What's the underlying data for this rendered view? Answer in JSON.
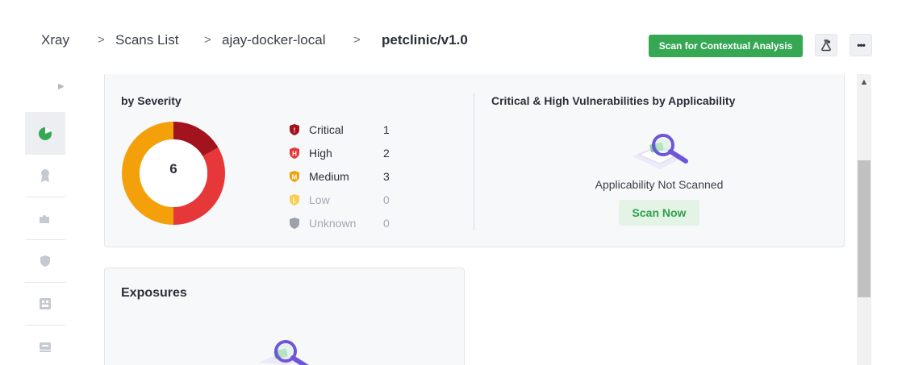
{
  "breadcrumb": {
    "items": [
      "Xray",
      "Scans List",
      "ajay-docker-local",
      "petclinic/v1.0"
    ],
    "separator": ">"
  },
  "header": {
    "contextual_button": "Scan for Contextual Analysis",
    "icons": [
      "lab-flask-icon",
      "more-options-icon"
    ],
    "more_label": "•••"
  },
  "rail": {
    "toggle_icon": "expand-arrow-icon",
    "items": [
      "pie-chart-icon",
      "award-badge-icon",
      "puzzle-icon",
      "shield-icon",
      "dependencies-icon",
      "layers-icon"
    ]
  },
  "severity": {
    "title": "by Severity",
    "total": "6",
    "levels": [
      {
        "label": "Critical",
        "count": "1",
        "color": "#a3131e",
        "letter": "!"
      },
      {
        "label": "High",
        "count": "2",
        "color": "#e63838",
        "letter": "H"
      },
      {
        "label": "Medium",
        "count": "3",
        "color": "#f4a00b",
        "letter": "M"
      },
      {
        "label": "Low",
        "count": "0",
        "color": "#f8cf52",
        "letter": "L"
      },
      {
        "label": "Unknown",
        "count": "0",
        "color": "#9ca1ab",
        "letter": ""
      }
    ]
  },
  "applicability": {
    "title": "Critical & High Vulnerabilities by Applicability",
    "status": "Applicability Not Scanned",
    "action": "Scan Now"
  },
  "exposures": {
    "title": "Exposures"
  },
  "colors": {
    "accent_green": "#36a854",
    "critical": "#a3131e",
    "high": "#e63838",
    "medium": "#f4a00b"
  }
}
